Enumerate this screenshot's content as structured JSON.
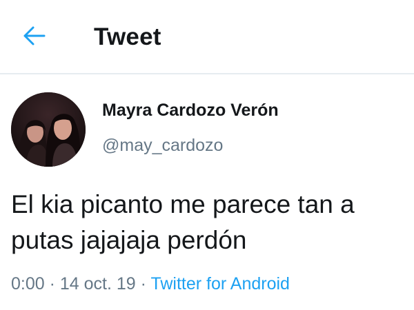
{
  "header": {
    "title": "Tweet",
    "back_icon": "back-arrow-icon",
    "accent_color": "#1da1f2"
  },
  "author": {
    "display_name": "Mayra Cardozo Verón",
    "handle": "@may_cardozo"
  },
  "tweet": {
    "lines": [
      "El kia picanto me parece tan a",
      "putas jajajaja perdón"
    ]
  },
  "meta": {
    "time": "0:00",
    "separator": " · ",
    "date": "14 oct. 19",
    "source": "Twitter for Android"
  }
}
